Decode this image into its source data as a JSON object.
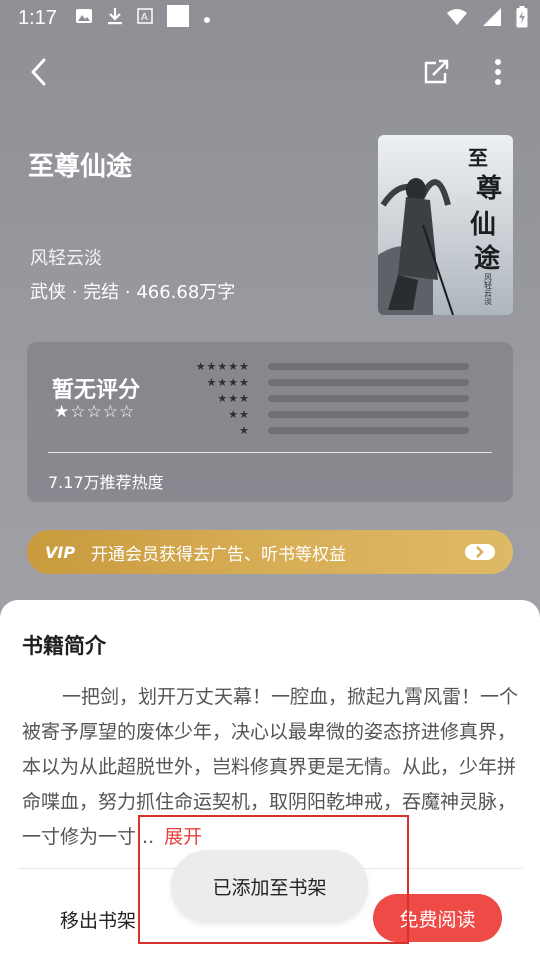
{
  "status_bar": {
    "time": "1:17",
    "left_icons": [
      "image-icon",
      "download-icon",
      "text-a-icon",
      "square-icon",
      "dot-icon"
    ],
    "right_icons": [
      "wifi-icon",
      "signal-icon",
      "battery-icon"
    ]
  },
  "toolbar": {
    "back_icon": "chevron-left-icon",
    "share_icon": "share-icon",
    "more_icon": "more-vertical-icon"
  },
  "book": {
    "title": "至尊仙途",
    "author": "风轻云淡",
    "meta": "武侠 · 完结 · 466.68万字",
    "cover_title_chars": "至尊仙途",
    "cover_author": "风轻云淡"
  },
  "rating": {
    "label": "暂无评分",
    "stars_display": "★☆☆☆☆",
    "star_rows": [
      "★★★★★",
      "★★★★",
      "★★★",
      "★★",
      "★"
    ],
    "heat_text": "7.17万推荐热度"
  },
  "vip": {
    "badge": "VIP",
    "text": "开通会员获得去广告、听书等权益"
  },
  "intro": {
    "heading": "书籍简介",
    "text": "一把剑，划开万丈天幕！一腔血，掀起九霄风雷！一个被寄予厚望的废体少年，决心以最卑微的姿态挤进修真界，本以为从此超脱世外，岂料修真界更是无情。从此，少年拼命喋血，努力抓住命运契机，取阴阳乾坤戒，吞魔神灵脉，一寸修为一寸...",
    "expand_label": "展开"
  },
  "actions": {
    "remove_label": "移出书架",
    "read_label": "免费阅读"
  },
  "toast": {
    "message": "已添加至书架"
  },
  "colors": {
    "accent": "#ee4a46",
    "vip_gold": "#d7ad55",
    "highlight_box": "#d9322e"
  }
}
